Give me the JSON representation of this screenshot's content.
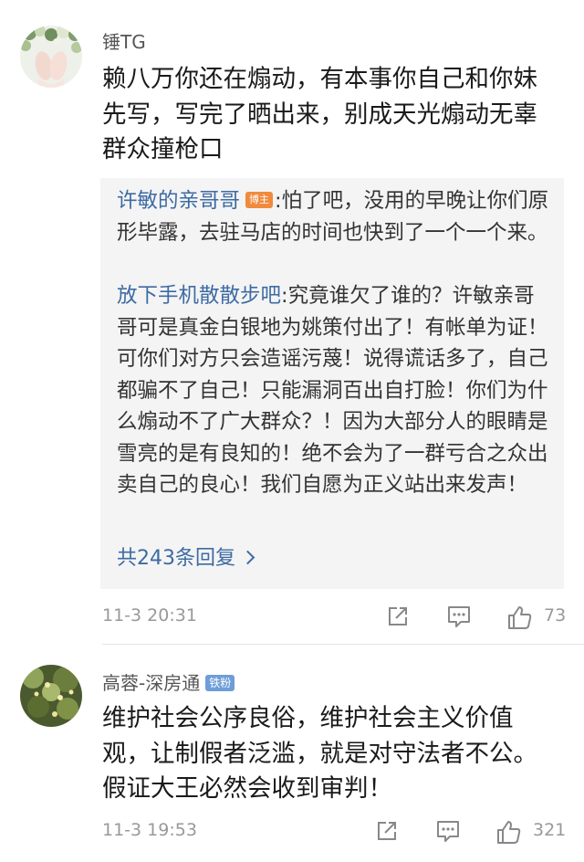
{
  "comments": [
    {
      "username": "锤TG",
      "text": "赖八万你还在煽动，有本事你自己和你妹先写，写完了晒出来，别成天光煽动无辜群众撞枪口",
      "replies": [
        {
          "name": "许敏的亲哥哥",
          "badge": "博主",
          "text": ":怕了吧，没用的早晚让你们原形毕露，去驻马店的时间也快到了一个一个来。"
        },
        {
          "name": "放下手机散散步吧",
          "text": ":究竟谁欠了谁的？许敏亲哥哥可是真金白银地为姚策付出了！有帐单为证！可你们对方只会造谣污蔑！说得谎话多了，自己都骗不了自己！只能漏洞百出自打脸！你们为什么煽动不了广大群众？！因为大部分人的眼睛是雪亮的是有良知的！绝不会为了一群亏合之众出卖自己的良心！我们自愿为正义站出来发声！"
        }
      ],
      "more_replies": "共243条回复",
      "time": "11-3 20:31",
      "likes": "73",
      "icons": [
        "share-icon",
        "comment-icon",
        "like-icon"
      ]
    },
    {
      "username": "高蓉-深房通",
      "badge": "铁粉",
      "text": "维护社会公序良俗，维护社会主义价值观，让制假者泛滥，就是对守法者不公。假证大王必然会收到审判！",
      "time": "11-3 19:53",
      "likes": "321",
      "icons": [
        "share-icon",
        "comment-icon",
        "like-icon"
      ]
    }
  ],
  "colors": {
    "link": "#3d6ba3",
    "badge_owner": "#f08a3c",
    "badge_fan": "#6e9ed9",
    "meta": "#999999",
    "reply_bg": "#f4f4f4"
  }
}
